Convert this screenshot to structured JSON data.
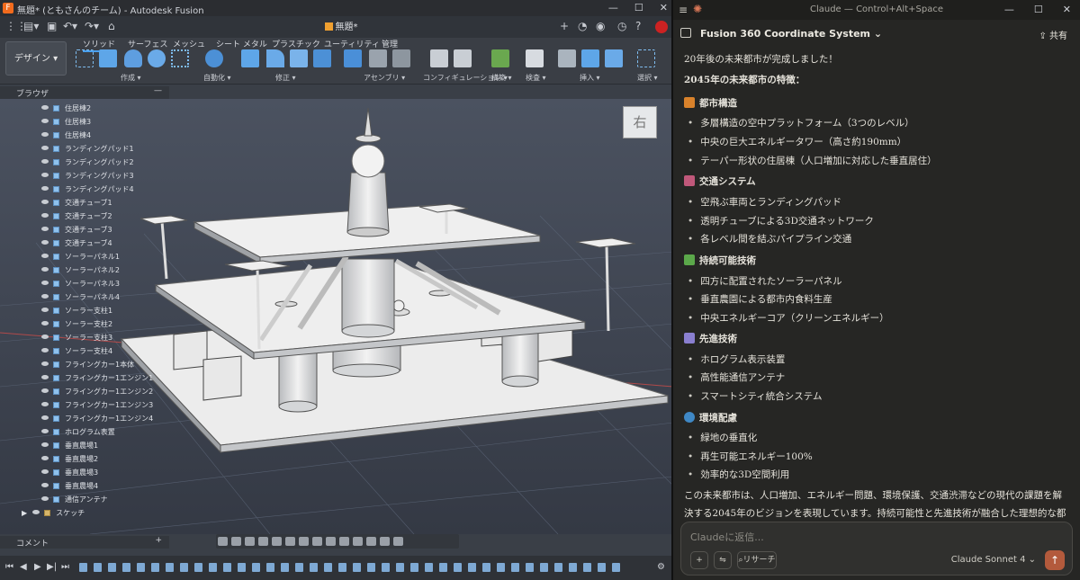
{
  "fusion": {
    "window_title": "無題* (ともさんのチーム) - Autodesk Fusion",
    "document_tab": "無題*",
    "workspace_button": "デザイン ▾",
    "ribbon_tabs": [
      "ソリッド",
      "サーフェス",
      "メッシュ",
      "シート メタル",
      "プラスチック",
      "ユーティリティ",
      "管理"
    ],
    "ribbon_groups": [
      "作成 ▾",
      "自動化 ▾",
      "修正 ▾",
      "アセンブリ ▾",
      "コンフィギュレーション ▾",
      "構築 ▾",
      "検査 ▾",
      "挿入 ▾",
      "選択 ▾"
    ],
    "browser_title": "ブラウザ",
    "browser_items": [
      "住居棟2",
      "住居棟3",
      "住居棟4",
      "ランディングパッド1",
      "ランディングパッド2",
      "ランディングパッド3",
      "ランディングパッド4",
      "交通チューブ1",
      "交通チューブ2",
      "交通チューブ3",
      "交通チューブ4",
      "ソーラーパネル1",
      "ソーラーパネル2",
      "ソーラーパネル3",
      "ソーラーパネル4",
      "ソーラー支柱1",
      "ソーラー支柱2",
      "ソーラー支柱3",
      "ソーラー支柱4",
      "フライングカー1本体",
      "フライングカー1エンジン1",
      "フライングカー1エンジン2",
      "フライングカー1エンジン3",
      "フライングカー1エンジン4",
      "ホログラム表置",
      "垂直農場1",
      "垂直農場2",
      "垂直農場3",
      "垂直農場4",
      "通信アンテナ"
    ],
    "sketch_folder": "スケッチ",
    "comment_label": "コメント",
    "viewcube_label": "右"
  },
  "claude": {
    "window_title": "Claude — Control+Alt+Space",
    "conversation_title": "Fusion 360 Coordinate System ⌄",
    "share_label": "共有",
    "intro": "20年後の未来都市が完成しました！",
    "features_heading": "2045年の未来都市の特徴：",
    "sections": [
      {
        "title": "都市構造",
        "color": "#d9822b",
        "items": [
          "多層構造の空中プラットフォーム（3つのレベル）",
          "中央の巨大エネルギータワー（高さ約190mm）",
          "テーパー形状の住居棟（人口増加に対応した垂直居住）"
        ]
      },
      {
        "title": "交通システム",
        "color": "#c0587a",
        "items": [
          "空飛ぶ車両とランディングパッド",
          "透明チューブによる3D交通ネットワーク",
          "各レベル間を結ぶパイプライン交通"
        ]
      },
      {
        "title": "持続可能技術",
        "color": "#5ba84a",
        "items": [
          "四方に配置されたソーラーパネル",
          "垂直農園による都市内食料生産",
          "中央エネルギーコア（クリーンエネルギー）"
        ]
      },
      {
        "title": "先進技術",
        "color": "#8a7fd0",
        "items": [
          "ホログラム表示装置",
          "高性能通信アンテナ",
          "スマートシティ統合システム"
        ]
      },
      {
        "title": "環境配慮",
        "color": "#3f88c5",
        "items": [
          "緑地の垂直化",
          "再生可能エネルギー100%",
          "効率的な3D空間利用"
        ]
      }
    ],
    "summary": "この未来都市は、人口増加、エネルギー問題、環境保護、交通渋滞などの現代の課題を解決する2045年のビジョンを表現しています。持続可能性と先進技術が融合した理想的な都市モ",
    "input_placeholder": "Claudeに返信...",
    "research_label": "リサーチ",
    "model_label": "Claude Sonnet 4 ⌄"
  }
}
